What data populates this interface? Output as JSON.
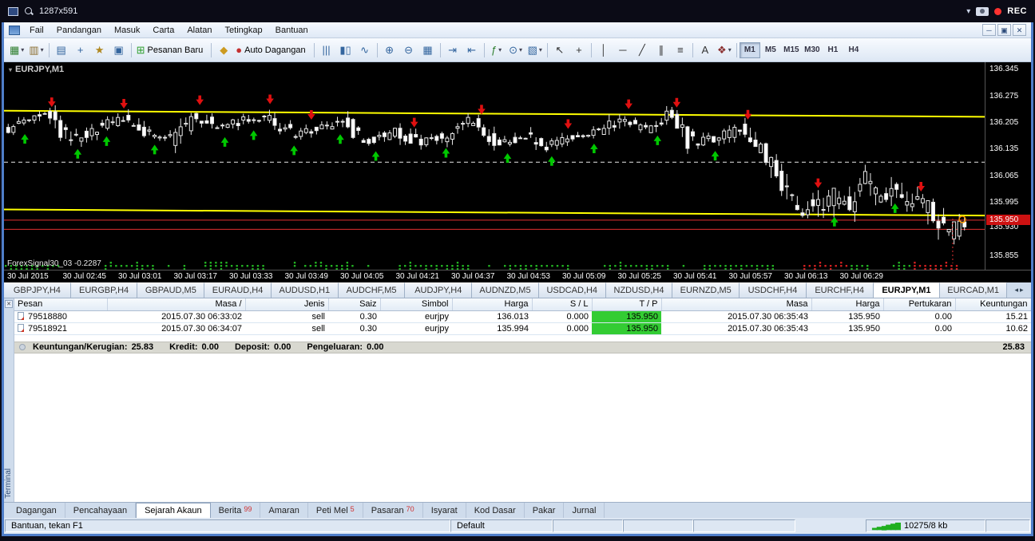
{
  "recorder": {
    "title": "1287x591",
    "rec_label": "REC",
    "dropdown_glyph": "▾"
  },
  "menu": {
    "items": [
      "Fail",
      "Pandangan",
      "Masuk",
      "Carta",
      "Alatan",
      "Tetingkap",
      "Bantuan"
    ],
    "window_buttons": [
      {
        "name": "minimize-button",
        "glyph": "─"
      },
      {
        "name": "restore-button",
        "glyph": "▣"
      },
      {
        "name": "close-button",
        "glyph": "✕"
      }
    ]
  },
  "toolbar": {
    "items": [
      {
        "name": "new-chart-button",
        "glyph": "▦",
        "color": "#2f7f2f",
        "caret": "▾"
      },
      {
        "name": "profiles-button",
        "glyph": "▥",
        "color": "#8a6d2f",
        "caret": "▾"
      },
      {
        "sep": true
      },
      {
        "name": "market-watch-button",
        "glyph": "▤",
        "color": "#33659e"
      },
      {
        "name": "data-window-button",
        "glyph": "+",
        "color": "#33659e"
      },
      {
        "name": "navigator-button",
        "glyph": "★",
        "color": "#b08820"
      },
      {
        "name": "terminal-button",
        "glyph": "▣",
        "color": "#33659e"
      },
      {
        "sep": true
      },
      {
        "name": "new-order-button",
        "glyph": "⊞",
        "color": "#2f9f2f",
        "label": "Pesanan Baru"
      },
      {
        "sep": true
      },
      {
        "name": "metaeditor-button",
        "glyph": "◆",
        "color": "#cc9a20"
      },
      {
        "name": "auto-trading-button",
        "glyph": "●",
        "color": "#c43030",
        "label": "Auto Dagangan"
      },
      {
        "sep": true
      },
      {
        "name": "bar-chart-button",
        "glyph": "|||",
        "color": "#33659e"
      },
      {
        "name": "candlestick-chart-button",
        "glyph": "▮▯",
        "color": "#33659e"
      },
      {
        "name": "line-chart-button",
        "glyph": "∿",
        "color": "#33659e"
      },
      {
        "sep": true
      },
      {
        "name": "zoom-in-button",
        "glyph": "⊕",
        "color": "#33659e"
      },
      {
        "name": "zoom-out-button",
        "glyph": "⊖",
        "color": "#33659e"
      },
      {
        "name": "tile-windows-button",
        "glyph": "▦",
        "color": "#33659e"
      },
      {
        "sep": true
      },
      {
        "name": "auto-scroll-button",
        "glyph": "⇥",
        "color": "#33659e"
      },
      {
        "name": "chart-shift-button",
        "glyph": "⇤",
        "color": "#33659e"
      },
      {
        "sep": true
      },
      {
        "name": "indicators-button",
        "glyph": "ƒ",
        "color": "#2f7f2f",
        "caret": "▾"
      },
      {
        "name": "periods-button",
        "glyph": "⊙",
        "color": "#33659e",
        "caret": "▾"
      },
      {
        "name": "templates-button",
        "glyph": "▧",
        "color": "#33659e",
        "caret": "▾"
      },
      {
        "sep": true
      },
      {
        "name": "cursor-button",
        "glyph": "↖",
        "color": "#333333"
      },
      {
        "name": "crosshair-button",
        "glyph": "+",
        "color": "#333333"
      },
      {
        "sep": true
      },
      {
        "name": "vertical-line-button",
        "glyph": "│",
        "color": "#333333"
      },
      {
        "name": "horizontal-line-button",
        "glyph": "─",
        "color": "#333333"
      },
      {
        "name": "trendline-button",
        "glyph": "╱",
        "color": "#333333"
      },
      {
        "name": "channel-button",
        "glyph": "∥",
        "color": "#333333"
      },
      {
        "name": "fibonacci-button",
        "glyph": "≡",
        "color": "#333333"
      },
      {
        "sep": true
      },
      {
        "name": "text-button",
        "glyph": "A",
        "color": "#333333"
      },
      {
        "name": "arrows-tool-button",
        "glyph": "❖",
        "color": "#8a2f2f",
        "caret": "▾"
      }
    ],
    "timeframes": [
      {
        "label": "M1",
        "active": true
      },
      {
        "label": "M5"
      },
      {
        "label": "M15"
      },
      {
        "label": "M30"
      },
      {
        "label": "H1"
      },
      {
        "label": "H4"
      }
    ]
  },
  "chart": {
    "symbol_label": "EURJPY,M1",
    "symbol_marker": "▾",
    "indicator_label": "ForexSignal30_03 -0.2287",
    "current_price": "135.950",
    "price_scale": [
      "136.345",
      "136.275",
      "136.205",
      "136.135",
      "136.065",
      "135.995",
      "135.930",
      "135.855"
    ],
    "time_labels": [
      "30 Jul 2015",
      "30 Jul 02:45",
      "30 Jul 03:01",
      "30 Jul 03:17",
      "30 Jul 03:33",
      "30 Jul 03:49",
      "30 Jul 04:05",
      "30 Jul 04:21",
      "30 Jul 04:37",
      "30 Jul 04:53",
      "30 Jul 05:09",
      "30 Jul 05:25",
      "30 Jul 05:41",
      "30 Jul 05:57",
      "30 Jul 06:13",
      "30 Jul 06:29"
    ],
    "lines": {
      "yellow_upper": [
        136.237,
        136.221
      ],
      "yellow_lower": [
        135.978,
        135.962
      ],
      "white_dashed": 136.102,
      "red_solid": [
        135.95,
        135.926
      ]
    },
    "price_path": [
      [
        0,
        136.185
      ],
      [
        0.02,
        136.205
      ],
      [
        0.045,
        136.225
      ],
      [
        0.07,
        136.16
      ],
      [
        0.1,
        136.195
      ],
      [
        0.125,
        136.215
      ],
      [
        0.15,
        136.18
      ],
      [
        0.175,
        136.165
      ],
      [
        0.2,
        136.225
      ],
      [
        0.225,
        136.195
      ],
      [
        0.25,
        136.21
      ],
      [
        0.275,
        136.225
      ],
      [
        0.3,
        136.175
      ],
      [
        0.33,
        136.19
      ],
      [
        0.355,
        136.21
      ],
      [
        0.38,
        136.155
      ],
      [
        0.41,
        136.185
      ],
      [
        0.435,
        136.15
      ],
      [
        0.46,
        136.17
      ],
      [
        0.49,
        136.21
      ],
      [
        0.515,
        136.15
      ],
      [
        0.545,
        136.17
      ],
      [
        0.57,
        136.145
      ],
      [
        0.6,
        136.175
      ],
      [
        0.625,
        136.185
      ],
      [
        0.645,
        136.215
      ],
      [
        0.67,
        136.19
      ],
      [
        0.695,
        136.225
      ],
      [
        0.72,
        136.15
      ],
      [
        0.745,
        136.165
      ],
      [
        0.77,
        136.19
      ],
      [
        0.79,
        136.135
      ],
      [
        0.805,
        136.1
      ],
      [
        0.818,
        136.03
      ],
      [
        0.83,
        135.975
      ],
      [
        0.845,
        136.005
      ],
      [
        0.858,
        135.975
      ],
      [
        0.872,
        136.02
      ],
      [
        0.885,
        135.985
      ],
      [
        0.9,
        136.075
      ],
      [
        0.915,
        136.0
      ],
      [
        0.93,
        136.035
      ],
      [
        0.945,
        135.985
      ],
      [
        0.958,
        136.005
      ],
      [
        0.97,
        135.965
      ],
      [
        0.985,
        135.915
      ],
      [
        1,
        135.94
      ]
    ],
    "arrows": [
      {
        "t": 0.02,
        "dir": "up"
      },
      {
        "t": 0.048,
        "dir": "down"
      },
      {
        "t": 0.075,
        "dir": "up"
      },
      {
        "t": 0.105,
        "dir": "up"
      },
      {
        "t": 0.123,
        "dir": "down"
      },
      {
        "t": 0.155,
        "dir": "up"
      },
      {
        "t": 0.202,
        "dir": "down"
      },
      {
        "t": 0.228,
        "dir": "up"
      },
      {
        "t": 0.258,
        "dir": "up"
      },
      {
        "t": 0.275,
        "dir": "down"
      },
      {
        "t": 0.3,
        "dir": "up"
      },
      {
        "t": 0.318,
        "dir": "down"
      },
      {
        "t": 0.348,
        "dir": "up"
      },
      {
        "t": 0.385,
        "dir": "up"
      },
      {
        "t": 0.425,
        "dir": "down"
      },
      {
        "t": 0.458,
        "dir": "up"
      },
      {
        "t": 0.495,
        "dir": "down"
      },
      {
        "t": 0.522,
        "dir": "up"
      },
      {
        "t": 0.568,
        "dir": "up"
      },
      {
        "t": 0.585,
        "dir": "down"
      },
      {
        "t": 0.612,
        "dir": "up"
      },
      {
        "t": 0.648,
        "dir": "down"
      },
      {
        "t": 0.678,
        "dir": "up"
      },
      {
        "t": 0.698,
        "dir": "down"
      },
      {
        "t": 0.738,
        "dir": "up"
      },
      {
        "t": 0.772,
        "dir": "down"
      },
      {
        "t": 0.845,
        "dir": "down"
      },
      {
        "t": 0.862,
        "dir": "up"
      },
      {
        "t": 0.925,
        "dir": "up"
      },
      {
        "t": 0.952,
        "dir": "down"
      }
    ],
    "marker_circle": {
      "x_frac": 0.995,
      "price": 135.952
    }
  },
  "symbol_tabs": {
    "items": [
      {
        "label": "GBPJPY,H4"
      },
      {
        "label": "EURGBP,H4"
      },
      {
        "label": "GBPAUD,M5"
      },
      {
        "label": "EURAUD,H4"
      },
      {
        "label": "AUDUSD,H1"
      },
      {
        "label": "AUDCHF,M5"
      },
      {
        "label": "AUDJPY,H4"
      },
      {
        "label": "AUDNZD,M5"
      },
      {
        "label": "USDCAD,H4"
      },
      {
        "label": "NZDUSD,H4"
      },
      {
        "label": "EURNZD,M5"
      },
      {
        "label": "USDCHF,H4"
      },
      {
        "label": "EURCHF,H4"
      },
      {
        "label": "EURJPY,M1",
        "active": true
      },
      {
        "label": "EURCAD,M1"
      }
    ],
    "scroll_left": "◂",
    "scroll_right": "▸"
  },
  "terminal": {
    "panel_label": "Terminal",
    "close_glyph": "✕",
    "columns": [
      "Pesan",
      "Masa /",
      "Jenis",
      "Saiz",
      "Simbol",
      "Harga",
      "S / L",
      "T / P",
      "Masa",
      "Harga",
      "Pertukaran",
      "Keuntungan"
    ],
    "rows": [
      {
        "order": "79518880",
        "open_time": "2015.07.30 06:33:02",
        "type": "sell",
        "size": "0.30",
        "symbol": "eurjpy",
        "open_price": "136.013",
        "sl": "0.000",
        "tp": "135.950",
        "close_time": "2015.07.30 06:35:43",
        "close_price": "135.950",
        "swap": "0.00",
        "profit": "15.21"
      },
      {
        "order": "79518921",
        "open_time": "2015.07.30 06:34:07",
        "type": "sell",
        "size": "0.30",
        "symbol": "eurjpy",
        "open_price": "135.994",
        "sl": "0.000",
        "tp": "135.950",
        "close_time": "2015.07.30 06:35:43",
        "close_price": "135.950",
        "swap": "0.00",
        "profit": "10.62"
      }
    ],
    "summary": {
      "profit_label": "Keuntungan/Kerugian:",
      "profit_value": "25.83",
      "credit_label": "Kredit:",
      "credit_value": "0.00",
      "deposit_label": "Deposit:",
      "deposit_value": "0.00",
      "withdrawal_label": "Pengeluaran:",
      "withdrawal_value": "0.00",
      "total": "25.83"
    },
    "tabs": [
      {
        "label": "Dagangan"
      },
      {
        "label": "Pencahayaan"
      },
      {
        "label": "Sejarah Akaun",
        "active": true
      },
      {
        "label": "Berita",
        "badge": "99"
      },
      {
        "label": "Amaran"
      },
      {
        "label": "Peti Mel",
        "badge": "5"
      },
      {
        "label": "Pasaran",
        "badge": "70"
      },
      {
        "label": "Isyarat"
      },
      {
        "label": "Kod Dasar"
      },
      {
        "label": "Pakar"
      },
      {
        "label": "Jurnal"
      }
    ]
  },
  "status": {
    "help": "Bantuan, tekan F1",
    "profile": "Default",
    "traffic": "10275/8 kb",
    "traffic_bars": "▂▃▄▅▆▇"
  },
  "colors": {
    "tp_cell": "#33cc33",
    "yellow_line": "#ffff00",
    "red_line": "#e03030",
    "white_dash": "#e8e8e8",
    "candle": "#e8e8e8",
    "arrow_up": "#00c800",
    "arrow_down": "#e01010",
    "dot_green": "#22b022",
    "dot_red": "#d02020",
    "current_price_bg": "#cc1111",
    "marker_circle": "#ff9900"
  }
}
